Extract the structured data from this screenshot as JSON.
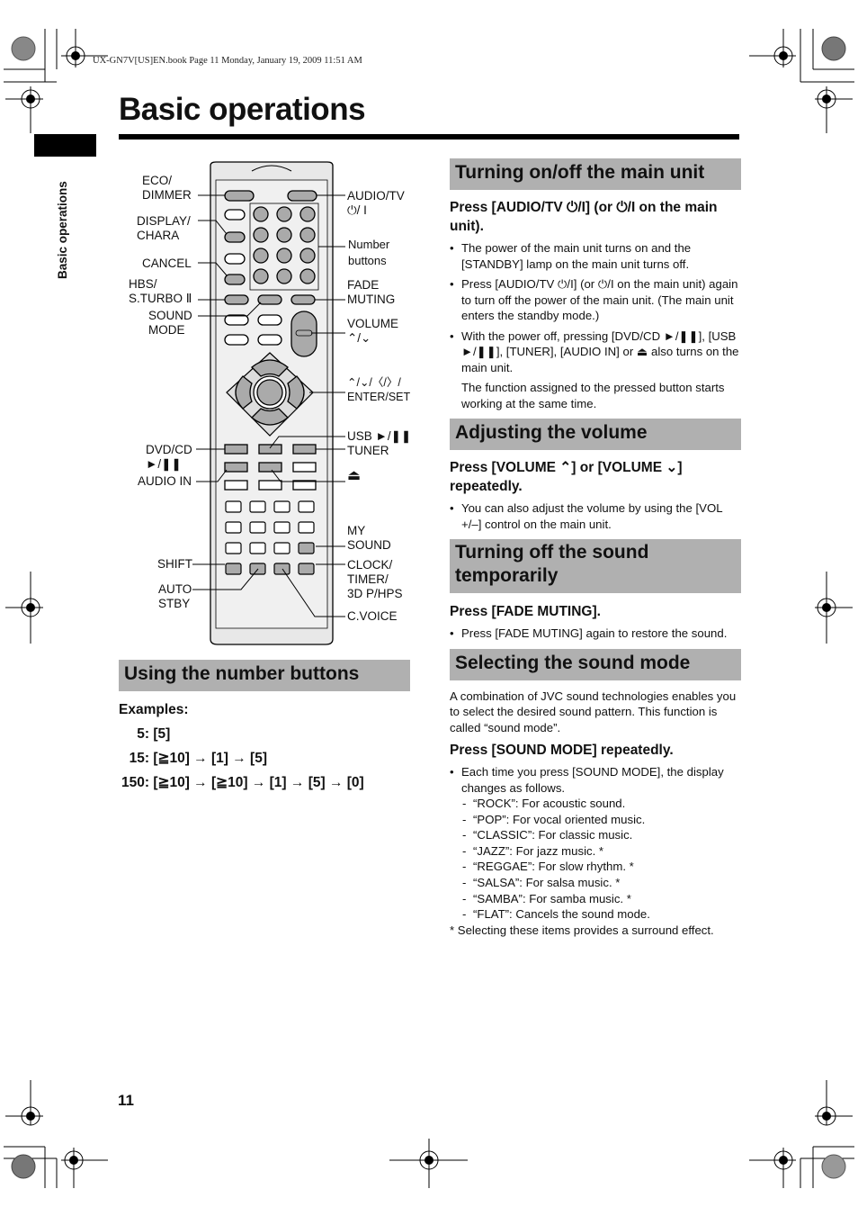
{
  "print_header": "UX-GN7V[US]EN.book  Page 11  Monday, January 19, 2009  11:51 AM",
  "page_title": "Basic operations",
  "side_tab_label": "Basic operations",
  "page_number": "11",
  "remote_diagram": {
    "labels": {
      "eco_dimmer": "ECO/\nDIMMER",
      "display_chara": "DISPLAY/\nCHARA",
      "cancel": "CANCEL",
      "hbs_sturbo": "HBS/\nS.TURBO Ⅱ",
      "sound_mode": "SOUND\nMODE",
      "audio_tv": "AUDIO/TV\n⏻/ I",
      "number_buttons": "Number\nbuttons",
      "fade_muting": "FADE\nMUTING",
      "volume": "VOLUME\n⌃/⌄",
      "cursor_enter": "⌃/⌄/〈/〉/\nENTER/SET",
      "usb_play": "USB ►/❚❚",
      "tuner": "TUNER",
      "dvd_cd": "DVD/CD\n►/❚❚",
      "audio_in": "AUDIO IN",
      "eject": "⏏",
      "my_sound": "MY\nSOUND",
      "shift": "SHIFT",
      "clock_timer": "CLOCK/\nTIMER/\n3D P/HPS",
      "auto_stby": "AUTO\nSTBY",
      "c_voice": "C.VOICE"
    }
  },
  "number_buttons_section": {
    "heading": "Using the number buttons",
    "examples_label": "Examples:",
    "examples": [
      {
        "number": "5:",
        "sequence": "[5]"
      },
      {
        "number": "15:",
        "sequence": "[≧10] → [1] → [5]"
      },
      {
        "number": "150:",
        "sequence": "[≧10] → [≧10] → [1] → [5] → [0]"
      }
    ]
  },
  "power_section": {
    "heading": "Turning on/off the main unit",
    "instruction": "Press [AUDIO/TV ⏻/I] (or ⏻/I on the main unit).",
    "bullets": [
      "The power of the main unit turns on and the [STANDBY] lamp on the main unit turns off.",
      "Press [AUDIO/TV ⏻/I] (or ⏻/I on the main unit) again to turn off the power of the main unit. (The main unit enters the standby mode.)",
      "With the power off, pressing [DVD/CD ►/❚❚], [USB ►/❚❚], [TUNER], [AUDIO IN] or ⏏ also turns on the main unit."
    ],
    "note": "The function assigned to the pressed button starts working at the same time."
  },
  "volume_section": {
    "heading": "Adjusting the volume",
    "instruction": "Press [VOLUME ⌃] or [VOLUME ⌄] repeatedly.",
    "bullets": [
      "You can also adjust the volume by using the [VOL +/–] control on the main unit."
    ]
  },
  "muting_section": {
    "heading": "Turning off the sound temporarily",
    "instruction": "Press [FADE MUTING].",
    "bullets": [
      "Press [FADE MUTING] again to restore the sound."
    ]
  },
  "sound_mode_section": {
    "heading": "Selecting the sound mode",
    "intro": "A combination of JVC sound technologies enables you to select the desired sound pattern. This function is called “sound mode”.",
    "instruction": "Press [SOUND MODE] repeatedly.",
    "bullet": "Each time you press [SOUND MODE], the display changes as follows.",
    "modes": [
      "“ROCK”: For acoustic sound.",
      "“POP”: For vocal oriented music.",
      "“CLASSIC”: For classic music.",
      "“JAZZ”: For jazz music. *",
      "“REGGAE”: For slow rhythm. *",
      "“SALSA”: For salsa music. *",
      "“SAMBA”: For samba music. *",
      "“FLAT”: Cancels the sound mode."
    ],
    "footnote": "* Selecting these items provides a surround effect."
  }
}
